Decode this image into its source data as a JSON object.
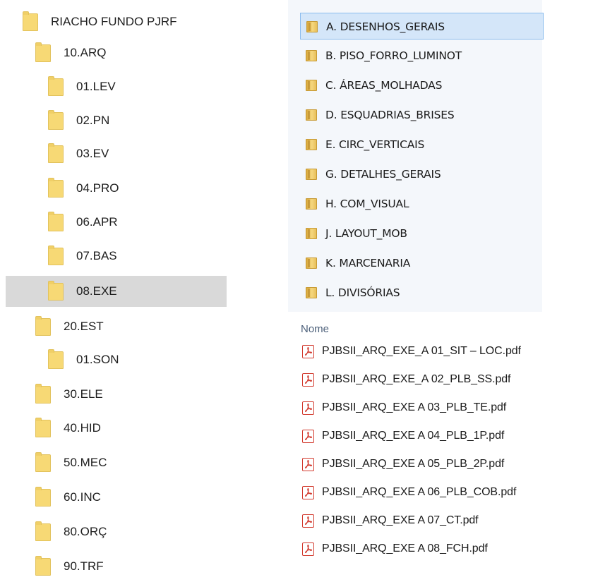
{
  "tree": {
    "items": [
      {
        "label": "RIACHO FUNDO PJRF",
        "level": 0,
        "selected": false
      },
      {
        "label": "10.ARQ",
        "level": 1,
        "selected": false
      },
      {
        "label": "01.LEV",
        "level": 2,
        "selected": false
      },
      {
        "label": "02.PN",
        "level": 2,
        "selected": false
      },
      {
        "label": "03.EV",
        "level": 2,
        "selected": false
      },
      {
        "label": "04.PRO",
        "level": 2,
        "selected": false
      },
      {
        "label": "06.APR",
        "level": 2,
        "selected": false
      },
      {
        "label": "07.BAS",
        "level": 2,
        "selected": false
      },
      {
        "label": "08.EXE",
        "level": 2,
        "selected": true
      },
      {
        "label": "20.EST",
        "level": 1,
        "selected": false
      },
      {
        "label": "01.SON",
        "level": 2,
        "selected": false
      },
      {
        "label": "30.ELE",
        "level": 1,
        "selected": false
      },
      {
        "label": "40.HID",
        "level": 1,
        "selected": false
      },
      {
        "label": "50.MEC",
        "level": 1,
        "selected": false
      },
      {
        "label": "60.INC",
        "level": 1,
        "selected": false
      },
      {
        "label": "80.ORÇ",
        "level": 1,
        "selected": false
      },
      {
        "label": "90.TRF",
        "level": 1,
        "selected": false
      }
    ]
  },
  "folders": {
    "items": [
      {
        "label": "A. DESENHOS_GERAIS",
        "selected": true
      },
      {
        "label": "B. PISO_FORRO_LUMINOT",
        "selected": false
      },
      {
        "label": "C. ÁREAS_MOLHADAS",
        "selected": false
      },
      {
        "label": "D. ESQUADRIAS_BRISES",
        "selected": false
      },
      {
        "label": "E. CIRC_VERTICAIS",
        "selected": false
      },
      {
        "label": "G. DETALHES_GERAIS",
        "selected": false
      },
      {
        "label": "H. COM_VISUAL",
        "selected": false
      },
      {
        "label": "J. LAYOUT_MOB",
        "selected": false
      },
      {
        "label": "K. MARCENARIA",
        "selected": false
      },
      {
        "label": "L. DIVISÓRIAS",
        "selected": false
      }
    ]
  },
  "files": {
    "column_header": "Nome",
    "items": [
      {
        "name": "PJBSII_ARQ_EXE_A 01_SIT – LOC.pdf",
        "icon": "pdf-icon"
      },
      {
        "name": "PJBSII_ARQ_EXE_A 02_PLB_SS.pdf",
        "icon": "pdf-icon"
      },
      {
        "name": "PJBSII_ARQ_EXE A 03_PLB_TE.pdf",
        "icon": "pdf-icon"
      },
      {
        "name": "PJBSII_ARQ_EXE A 04_PLB_1P.pdf",
        "icon": "pdf-icon"
      },
      {
        "name": "PJBSII_ARQ_EXE A 05_PLB_2P.pdf",
        "icon": "pdf-icon"
      },
      {
        "name": "PJBSII_ARQ_EXE A 06_PLB_COB.pdf",
        "icon": "pdf-icon"
      },
      {
        "name": "PJBSII_ARQ_EXE A 07_CT.pdf",
        "icon": "pdf-icon"
      },
      {
        "name": "PJBSII_ARQ_EXE A 08_FCH.pdf",
        "icon": "pdf-icon"
      }
    ]
  },
  "colors": {
    "tree_selected": "#d9d9d9",
    "folder_selected_bg": "#d4e6f9",
    "folder_selected_border": "#8bbcee",
    "folder_yellow": "#f7d975",
    "pdf_red": "#d23a2e",
    "header_text": "#4c607a"
  }
}
